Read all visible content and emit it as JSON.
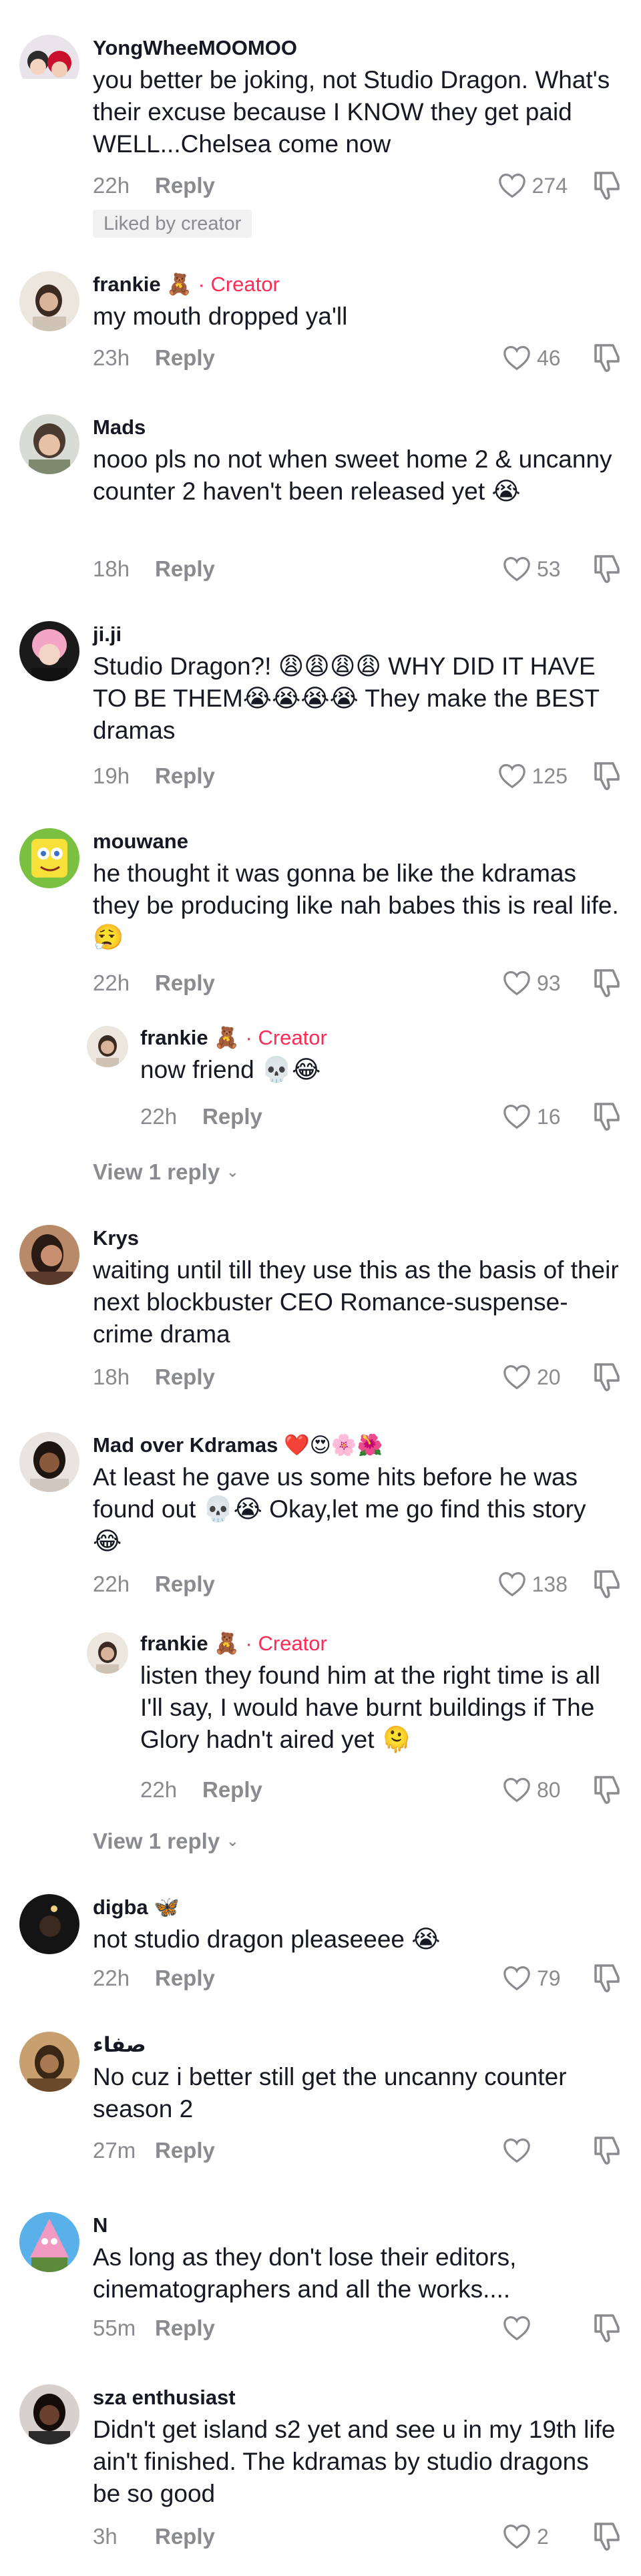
{
  "labels": {
    "reply": "Reply",
    "creator": "Creator",
    "liked_by_creator": "Liked by creator",
    "view_1_reply": "View 1 reply"
  },
  "comments": [
    {
      "username": "YongWheeMOOMOO",
      "text": "you better be joking, not Studio Dragon. What's their excuse because I KNOW they get paid WELL...Chelsea come now",
      "time": "22h",
      "likes": "274"
    },
    {
      "username": "frankie",
      "text": "my mouth dropped ya'll",
      "time": "23h",
      "likes": "46"
    },
    {
      "username": "Mads",
      "text": "nooo pls no not when sweet home 2 & uncanny counter 2 haven't been released yet 😭",
      "time": "18h",
      "likes": "53"
    },
    {
      "username": "ji.ji",
      "text": "Studio Dragon?! 😩😩😩😩 WHY DID IT HAVE TO BE THEM😭😭😭😭 They make the BEST dramas",
      "time": "19h",
      "likes": "125"
    },
    {
      "username": "mouwane",
      "text": "he thought it was gonna be like the kdramas they be producing like nah babes this is real life. 😮‍💨",
      "time": "22h",
      "likes": "93"
    },
    {
      "username": "frankie",
      "text": "now friend 💀😂",
      "time": "22h",
      "likes": "16"
    },
    {
      "username": "Krys",
      "text": "waiting until till they use this as the basis of their next blockbuster CEO Romance-suspense-crime drama",
      "time": "18h",
      "likes": "20"
    },
    {
      "username": "Mad over Kdramas ❤️😍🌸🌺",
      "text": "At least he gave us some hits before he was found out 💀😭 Okay,let me go find this story 😂",
      "time": "22h",
      "likes": "138"
    },
    {
      "username": "frankie",
      "text": "listen they found him at the right time is all I'll say, I would have burnt buildings if The Glory hadn't aired yet 🫠",
      "time": "22h",
      "likes": "80"
    },
    {
      "username": "digba 🦋",
      "text": "not studio dragon pleaseeee 😭",
      "time": "22h",
      "likes": "79"
    },
    {
      "username": "صفاء",
      "text": "No cuz i better still get the uncanny counter season 2",
      "time": "27m",
      "likes": ""
    },
    {
      "username": "N",
      "text": "As long as they don't lose their editors, cinematographers and all the works....",
      "time": "55m",
      "likes": ""
    },
    {
      "username": "sza enthusiast",
      "text": "Didn't get island s2 yet and see u in my 19th life ain't finished. The kdramas by studio dragons be so good",
      "time": "3h",
      "likes": "2"
    }
  ],
  "colors": {
    "creator_accent": "#fe2c55",
    "meta_gray": "#8a8b91",
    "text": "#161823",
    "badge_bg": "#f1f1f2"
  },
  "icons": {
    "like": "heart-outline-icon",
    "dislike": "thumbs-down-icon",
    "creator_badge": "teddy-bear-emoji",
    "expand": "chevron-down-icon"
  }
}
